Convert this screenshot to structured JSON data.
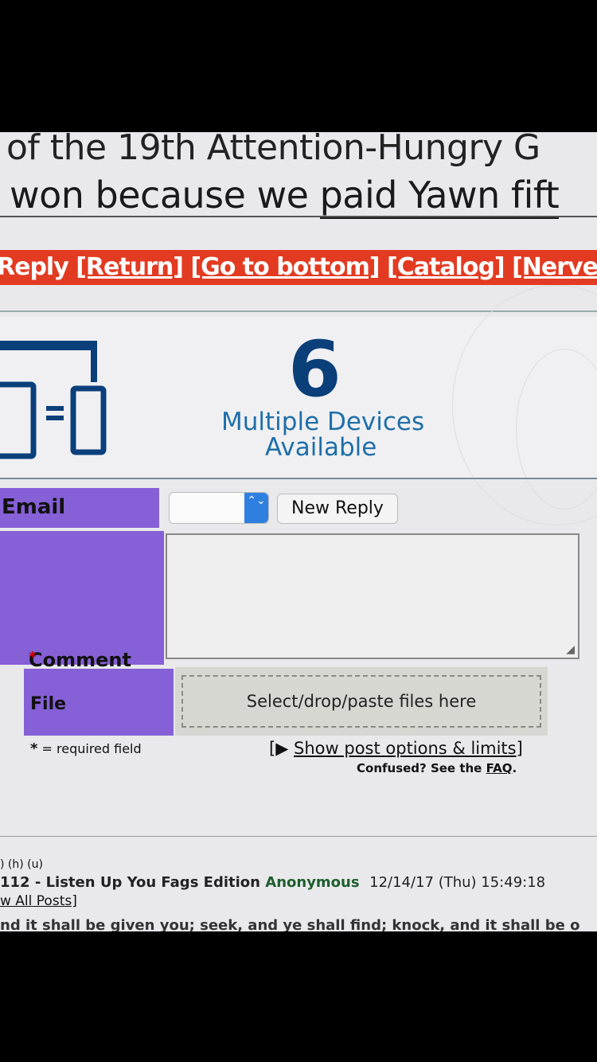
{
  "thread_title": {
    "line1": "of the 19th Attention-Hungry G",
    "line2_prefix": "won because we ",
    "line2_link": "paid Yawn fift"
  },
  "nav": {
    "reply": "Reply",
    "return": "[Return]",
    "bottom": "[Go to bottom]",
    "catalog": "[Catalog]",
    "nerve": "[Nerve Ce"
  },
  "ad": {
    "number": "6",
    "line1": "Multiple Devices",
    "line2": "Available"
  },
  "form": {
    "email_label": "Email",
    "select_arrows": "⌃⌄",
    "new_reply": "New Reply",
    "comment_label": "Comment",
    "required_star": "*",
    "comment_value": "",
    "file_label": "File",
    "drop_text": "Select/drop/paste files here",
    "required_note": "= required field",
    "show_options_open": "[▶ ",
    "show_options": "Show post options & limits",
    "show_options_close": "]",
    "confused": "Confused? See the ",
    "faq": "FAQ",
    "faq_end": "."
  },
  "thread": {
    "links": ") (h) (u)",
    "subject": "112 - Listen Up You Fags Edition",
    "author": "Anonymous",
    "date": "12/14/17 (Thu) 15:49:18",
    "view_all": "w All Posts]",
    "quote": "nd it shall be given you; seek, and ye shall find; knock, and it shall be o"
  },
  "colors": {
    "label_bg": "#8560d6",
    "nav_bg": "#e23b22",
    "ad_number": "#0a3f7a",
    "ad_text": "#1e6fa8"
  }
}
